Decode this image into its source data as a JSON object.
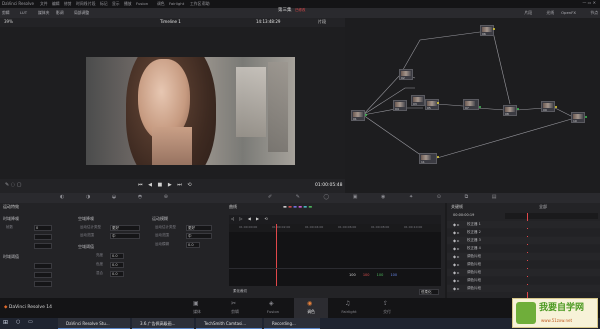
{
  "app": {
    "title": "DaVinci Resolve",
    "menu": [
      "文件",
      "编辑",
      "修剪",
      "时间线",
      "片段",
      "标记",
      "显示",
      "播放",
      "Fusion",
      "调色",
      "Fairlight",
      "工作区",
      "帮助"
    ],
    "project_title": "第三集",
    "project_status": "已修改"
  },
  "toolbar": {
    "left_items": [
      "剪辑",
      "LUT",
      "媒体夹",
      "影调",
      "局部调整"
    ],
    "right_items": [
      "节点",
      "OpenFX",
      "光线",
      "片段"
    ]
  },
  "viewer": {
    "zoom": "39%",
    "timeline_name": "Timeline 1",
    "timecode_top": "14:13:48:29",
    "mode_label": "片段",
    "timecode_bottom": "01:00:05:48"
  },
  "nodes": {
    "labels": [
      "01",
      "02",
      "03",
      "04",
      "05",
      "06",
      "07",
      "08",
      "09",
      "10",
      "11"
    ]
  },
  "panels": {
    "primaries_title": "运动特效",
    "primaries_rows": [
      "时域降噪",
      "空域降噪",
      "运动模糊"
    ],
    "primaries_fields": [
      {
        "label": "帧数",
        "value": "0"
      },
      {
        "label": "运动估计类型",
        "value": "更好"
      },
      {
        "label": "运动范围",
        "value": "中"
      },
      {
        "label": "运动估计类型",
        "value": "更好"
      },
      {
        "label": "运动范围",
        "value": "中"
      },
      {
        "label": "运动模糊",
        "value": "0.0"
      },
      {
        "label": "亮度",
        "value": "0.0"
      },
      {
        "label": "色度",
        "value": "0.0"
      },
      {
        "label": "亮度",
        "value": "0.0"
      },
      {
        "label": "色度",
        "value": "0.0"
      },
      {
        "label": "混合",
        "value": "0.0"
      }
    ],
    "keyframe_title": "关键帧",
    "keyframe_timecode": "00:00:00:19",
    "keyframe_header": "全部",
    "keyframe_rows": [
      "校正器 1",
      "校正器 2",
      "校正器 3",
      "校正器 4",
      "调色片段",
      "调色片段",
      "调色片段",
      "调色片段",
      "调色片段"
    ],
    "curves_title": "曲线",
    "curves_ticks": [
      "01:00:00:00",
      "01:00:02:00",
      "01:00:04:00",
      "01:00:06:00",
      "01:00:08:00",
      "01:00:10:00"
    ],
    "curve_labels": [
      "Y",
      "R",
      "G",
      "B"
    ],
    "curve_values": [
      "100",
      "100",
      "100",
      "100"
    ],
    "soft_clip_label": "柔化裁切",
    "soft_clip_value": "低柔化"
  },
  "bottom_tabs": [
    "媒体",
    "剪辑",
    "Fusion",
    "调色",
    "Fairlight",
    "交付"
  ],
  "bottom_tab_active": "调色",
  "bottom_app_label": "DaVinci Resolve 14",
  "taskbar": {
    "items": [
      "DaVinci Resolve Stu...",
      "3.6.广告佩高级画...",
      "TechSmith Camtasi...",
      "Recording..."
    ],
    "watermark_line1": "我要自学网",
    "watermark_line2": "www.51zxw.net"
  }
}
